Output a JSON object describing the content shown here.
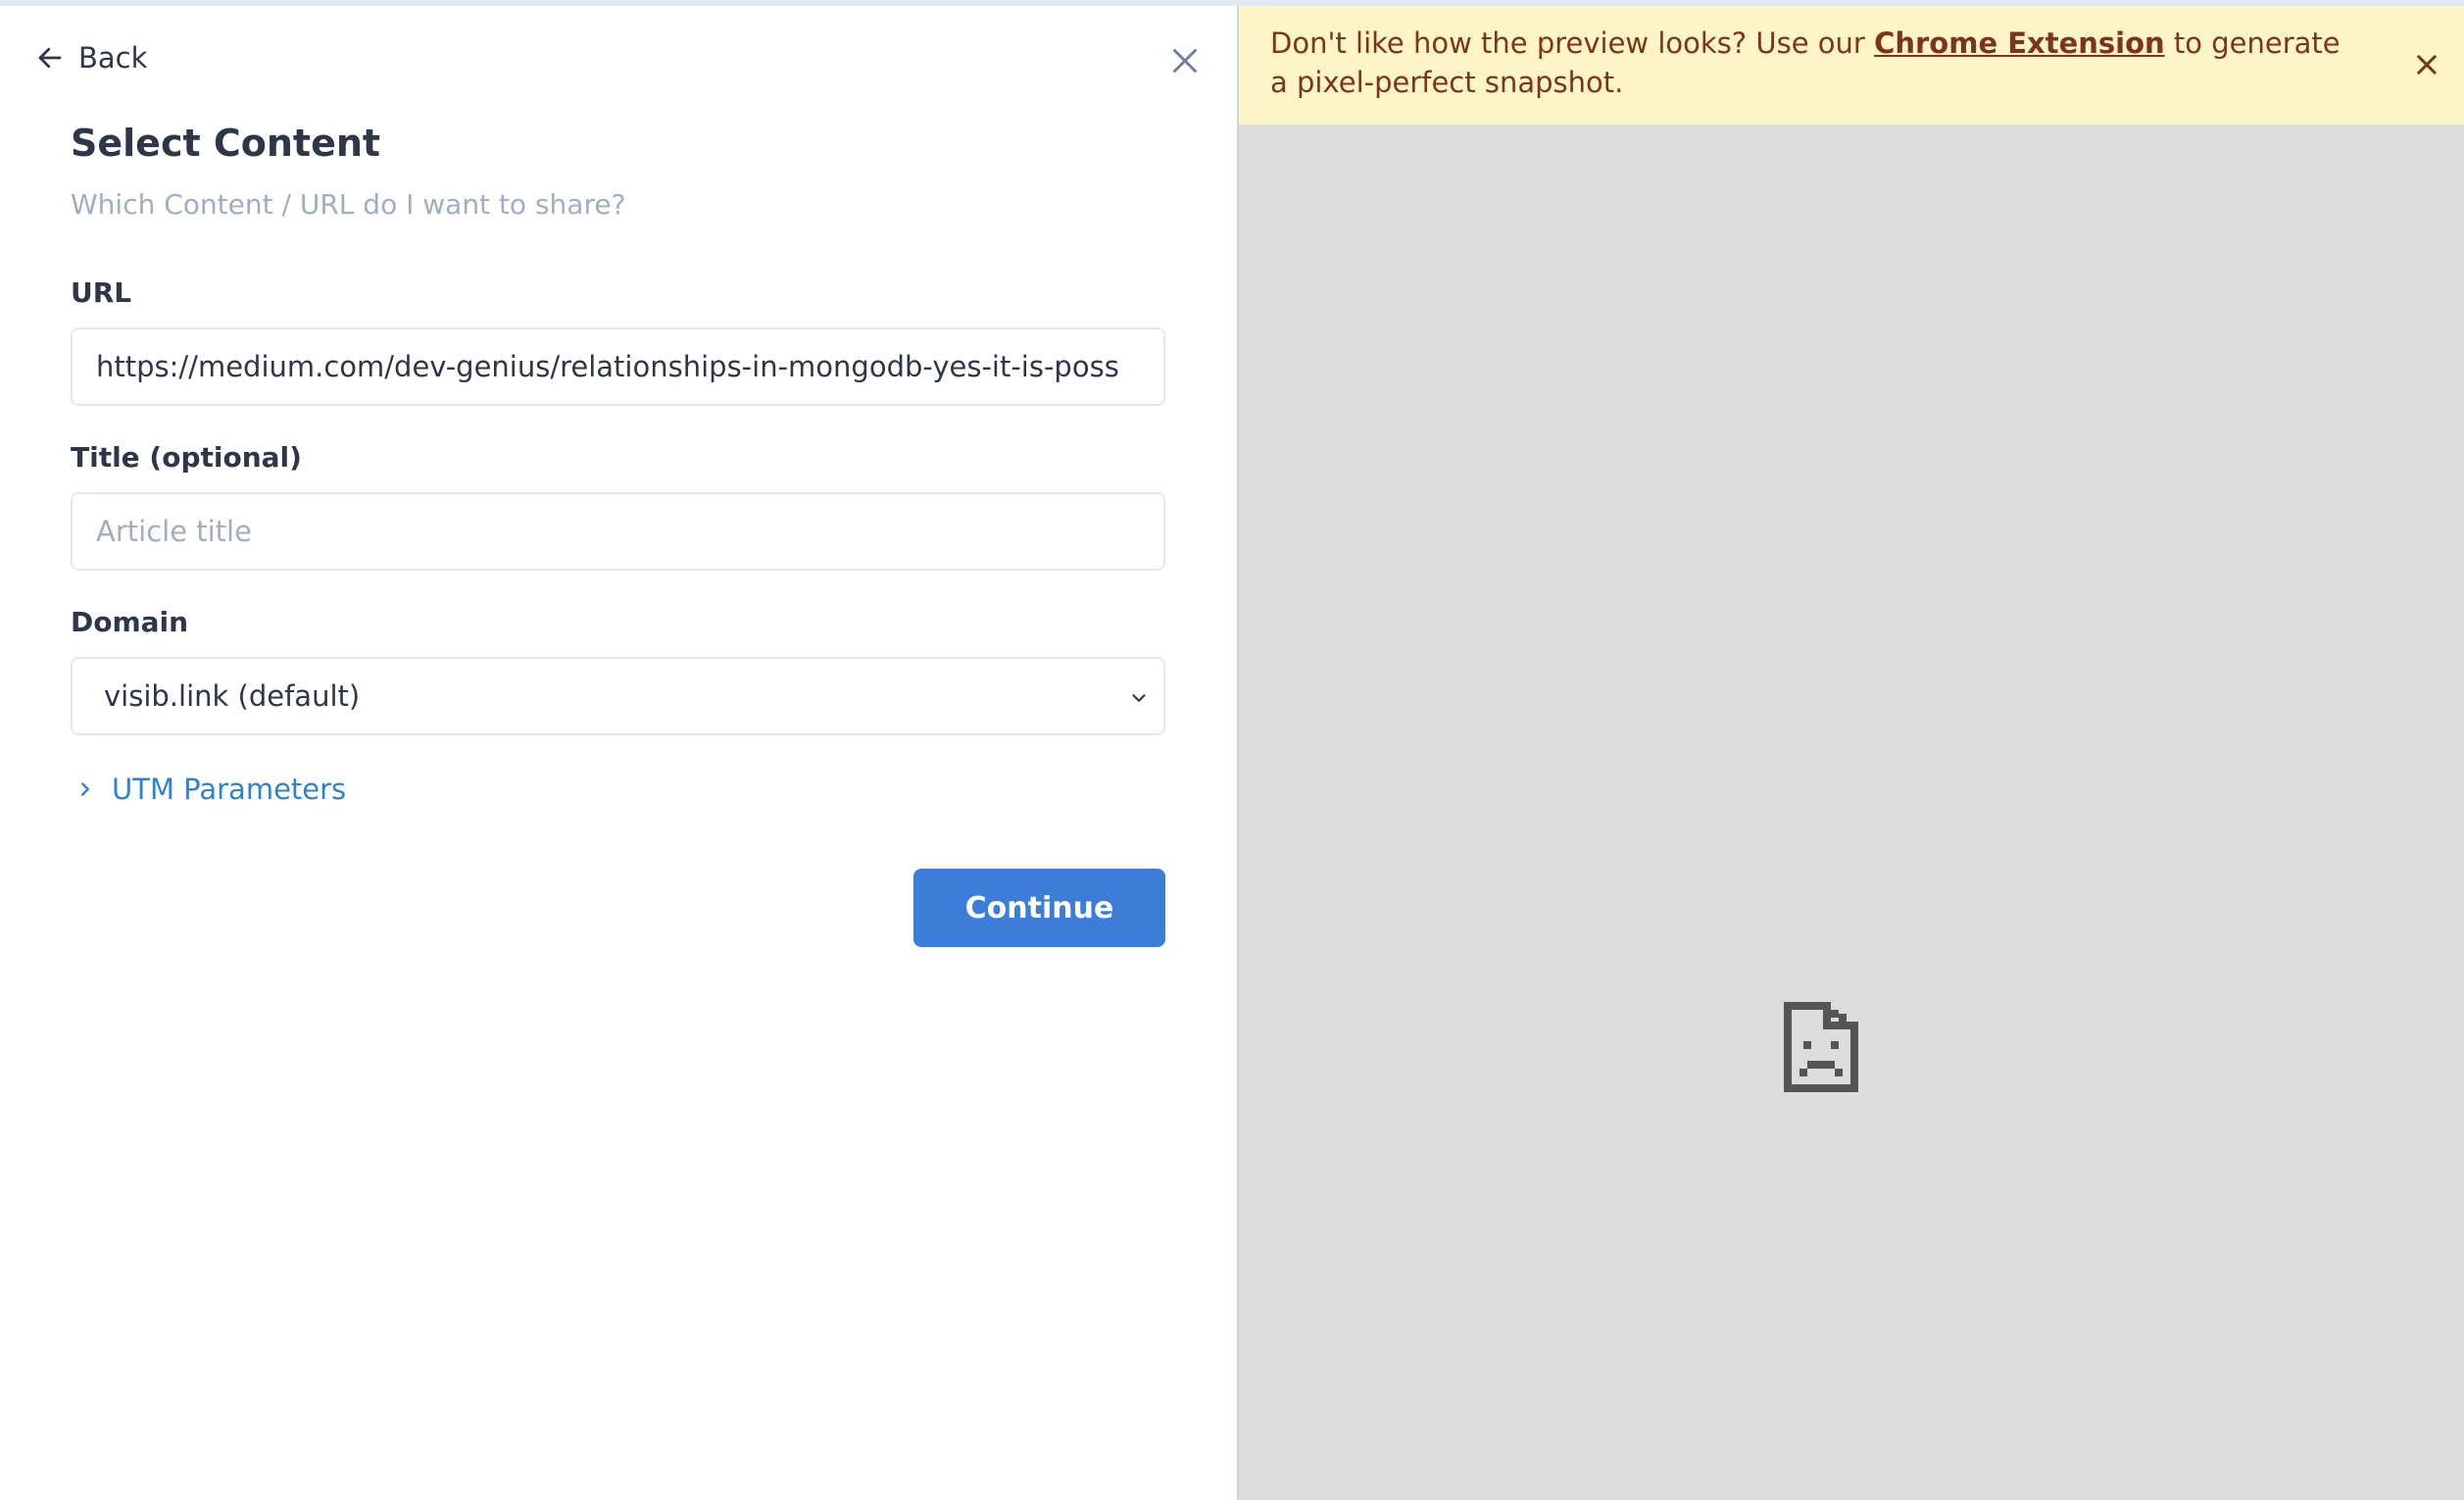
{
  "left_panel": {
    "back_label": "Back",
    "title": "Select Content",
    "subtitle": "Which Content / URL do I want to share?",
    "url": {
      "label": "URL",
      "value": "https://medium.com/dev-genius/relationships-in-mongodb-yes-it-is-poss"
    },
    "title_field": {
      "label": "Title (optional)",
      "placeholder": "Article title"
    },
    "domain": {
      "label": "Domain",
      "selected": "visib.link (default)"
    },
    "utm_label": "UTM Parameters",
    "continue_label": "Continue"
  },
  "preview_banner": {
    "text_before": "Don't like how the preview looks? Use our ",
    "link_text": "Chrome Extension",
    "text_after": " to generate a pixel-perfect snapshot."
  },
  "icons": {
    "back": "arrow-left-icon",
    "close": "close-icon",
    "select": "chevron-down-icon",
    "utm": "chevron-right-icon",
    "banner_close": "close-icon",
    "preview": "broken-document-icon"
  },
  "colors": {
    "primary": "#3b7dd8",
    "link": "#3182ce",
    "banner_bg": "#fdf4c8",
    "banner_text": "#7b341e",
    "preview_bg": "#dddddd"
  }
}
